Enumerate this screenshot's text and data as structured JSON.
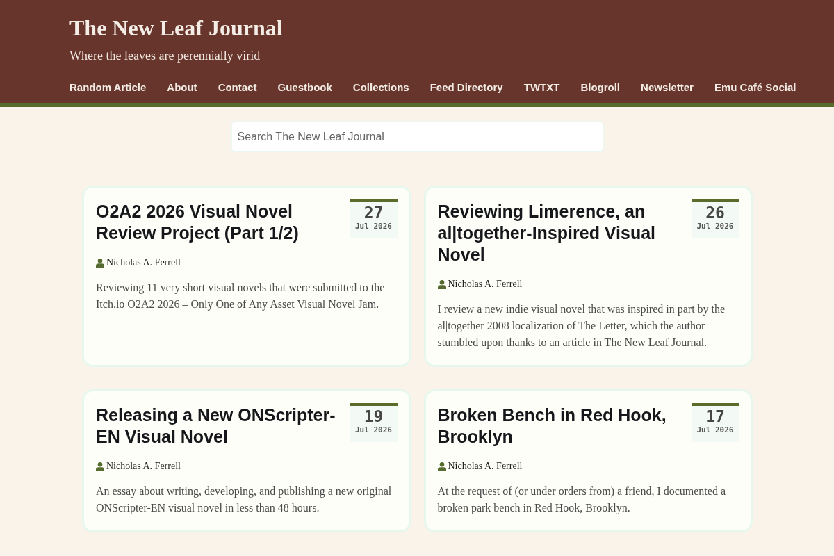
{
  "site": {
    "title": "The New Leaf Journal",
    "tagline": "Where the leaves are perennially virid"
  },
  "nav": [
    "Random Article",
    "About",
    "Contact",
    "Guestbook",
    "Collections",
    "Feed Directory",
    "TWTXT",
    "Blogroll",
    "Newsletter",
    "Emu Café Social"
  ],
  "search": {
    "placeholder": "Search The New Leaf Journal"
  },
  "posts": [
    {
      "title": "O2A2 2026 Visual Novel Review Project (Part 1/2)",
      "day": "27",
      "month_year": "Jul 2026",
      "author": "Nicholas A. Ferrell",
      "excerpt": "Reviewing 11 very short visual novels that were submitted to the Itch.io O2A2 2026 – Only One of Any Asset Visual Novel Jam."
    },
    {
      "title": "Reviewing Limerence, an al|together-Inspired Visual Novel",
      "day": "26",
      "month_year": "Jul 2026",
      "author": "Nicholas A. Ferrell",
      "excerpt": "I review a new indie visual novel that was inspired in part by the al|together 2008 localization of The Letter, which the author stumbled upon thanks to an article in The New Leaf Journal."
    },
    {
      "title": "Releasing a New ONScripter-EN Visual Novel",
      "day": "19",
      "month_year": "Jul 2026",
      "author": "Nicholas A. Ferrell",
      "excerpt": "An essay about writing, developing, and publishing a new original ONScripter-EN visual novel in less than 48 hours."
    },
    {
      "title": "Broken Bench in Red Hook, Brooklyn",
      "day": "17",
      "month_year": "Jul 2026",
      "author": "Nicholas A. Ferrell",
      "excerpt": "At the request of (or under orders from) a friend, I documented a broken park bench in Red Hook, Brooklyn."
    }
  ]
}
